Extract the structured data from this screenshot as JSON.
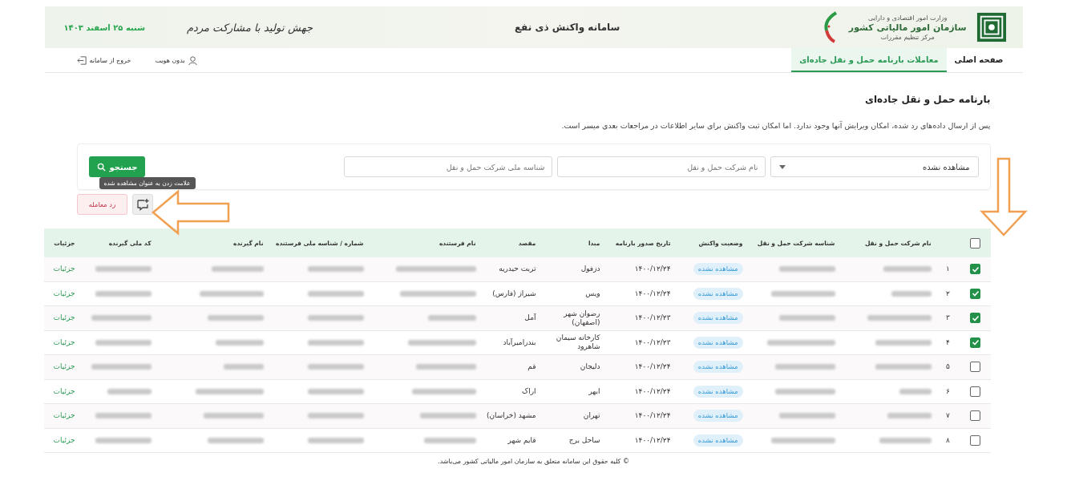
{
  "header": {
    "org_ministry": "وزارت امور اقتصادی و دارایی",
    "org_name": "سازمان امور مالیاتی کشور",
    "org_unit": "مرکز تنظیم مقررات",
    "system_title": "سامانه واکنش ذی نفع",
    "slogan": "جهش تولید با مشارکت مردم",
    "date": "شنبه ۲۵ اسفند ۱۴۰۳"
  },
  "nav": {
    "tabs": [
      {
        "label": "صفحه اصلی",
        "selected": false
      },
      {
        "label": "معاملات بارنامه حمل و نقل جاده‌ای",
        "selected": true
      }
    ],
    "user": "بدون هویت",
    "logout": "خروج از سامانه"
  },
  "page": {
    "title": "بارنامه حمل و نقل جاده‌ای",
    "description": "پس از ارسال داده‌های رد شده، امکان ویرایش آنها وجود ندارد. اما امکان ثبت واکنش برای سایر اطلاعات در مراجعات بعدی میسر است."
  },
  "filters": {
    "status_select": {
      "value": "مشاهده نشده"
    },
    "company_name": {
      "placeholder": "نام شرکت حمل و نقل"
    },
    "company_id": {
      "placeholder": "شناسه ملی شرکت حمل و نقل"
    },
    "search_button": "جستجو"
  },
  "actions": {
    "reject_button": "رد معامله",
    "tooltip": "علامت زدن به عنوان مشاهده شده"
  },
  "table": {
    "select_all_checked": false,
    "columns": [
      "نام شرکت حمل و نقل",
      "شناسه شرکت حمل و نقل",
      "وضعیت واکنش",
      "تاریخ صدور بارنامه",
      "مبدا",
      "مقصد",
      "نام فرستنده",
      "شماره / شناسه ملی فرستنده",
      "نام گیرنده",
      "کد ملی گیرنده",
      "جزئیات"
    ],
    "rows": [
      {
        "index": "۱",
        "checked": true,
        "status": "مشاهده نشده",
        "date": "۱۴۰۰/۱۲/۲۴",
        "origin": "دزفول",
        "destination": "تربت حیدریه",
        "link": "جزئیات"
      },
      {
        "index": "۲",
        "checked": true,
        "status": "مشاهده نشده",
        "date": "۱۴۰۰/۱۲/۲۴",
        "origin": "ویس",
        "destination": "شیراز (فارس)",
        "link": "جزئیات"
      },
      {
        "index": "۳",
        "checked": true,
        "status": "مشاهده نشده",
        "date": "۱۴۰۰/۱۲/۲۳",
        "origin": "رضوان شهر (اصفهان)",
        "destination": "آمل",
        "link": "جزئیات"
      },
      {
        "index": "۴",
        "checked": true,
        "status": "مشاهده نشده",
        "date": "۱۴۰۰/۱۲/۲۳",
        "origin": "کارخانه سیمان شاهرود",
        "destination": "بندرامیرآباد",
        "link": "جزئیات"
      },
      {
        "index": "۵",
        "checked": false,
        "status": "مشاهده نشده",
        "date": "۱۴۰۰/۱۲/۲۴",
        "origin": "دلیجان",
        "destination": "قم",
        "link": "جزئیات"
      },
      {
        "index": "۶",
        "checked": false,
        "status": "مشاهده نشده",
        "date": "۱۴۰۰/۱۲/۲۴",
        "origin": "ابهر",
        "destination": "اراک",
        "link": "جزئیات"
      },
      {
        "index": "۷",
        "checked": false,
        "status": "مشاهده نشده",
        "date": "۱۴۰۰/۱۲/۲۴",
        "origin": "تهران",
        "destination": "مشهد (خراسان)",
        "link": "جزئیات"
      },
      {
        "index": "۸",
        "checked": false,
        "status": "مشاهده نشده",
        "date": "۱۴۰۰/۱۲/۲۴",
        "origin": "ساحل برج",
        "destination": "قایم شهر",
        "link": "جزئیات"
      }
    ]
  },
  "footer": "© کلیه حقوق این سامانه متعلق به سازمان امور مالیاتی کشور می‌باشد."
}
